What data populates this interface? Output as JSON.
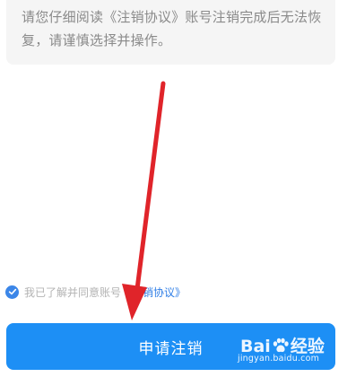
{
  "notice": {
    "text": "请您仔细阅读《注销协议》账号注销完成后无法恢复，请谨慎选择并操作。"
  },
  "agreement": {
    "checked": true,
    "prefix": "我已了解并同意账号",
    "link_label": "《注销协议》"
  },
  "submit_button": {
    "label": "申请注销"
  },
  "watermark": {
    "brand": "Bai 经验",
    "brand_left": "Bai",
    "brand_right": "经验",
    "url": "jingyan.baidu.com"
  },
  "colors": {
    "accent": "#1d8ff5",
    "link": "#2f7ee6",
    "annotation_arrow": "#e0242a",
    "notice_background": "#f5f5f5"
  }
}
